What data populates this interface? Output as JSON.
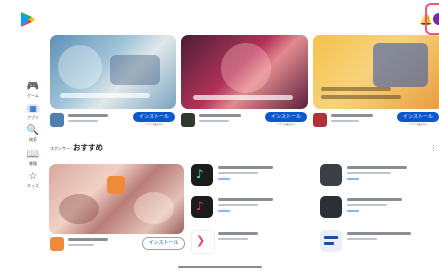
{
  "header": {
    "logo_icon": "play-store-logo",
    "bell_icon": "bell-icon",
    "avatar_color": "#7b2a9b"
  },
  "rail": [
    {
      "icon": "🎮",
      "label": "ゲーム",
      "name": "rail-games"
    },
    {
      "icon": "▦",
      "label": "アプリ",
      "name": "rail-apps",
      "active": true
    },
    {
      "icon": "🔍",
      "label": "検索",
      "name": "rail-search"
    },
    {
      "icon": "📖",
      "label": "書籍",
      "name": "rail-books"
    },
    {
      "icon": "☆",
      "label": "キッズ",
      "name": "rail-kids"
    }
  ],
  "featured": {
    "install_label": "インストール",
    "install_sub": "アプリ内課金あり"
  },
  "section": {
    "sponsor_label": "スポンサー・",
    "title": "おすすめ",
    "more": "⋮"
  },
  "recommend": {
    "install_label": "インストール"
  },
  "colors": {
    "accent": "#0b57d0",
    "highlight": "#e8577b"
  }
}
